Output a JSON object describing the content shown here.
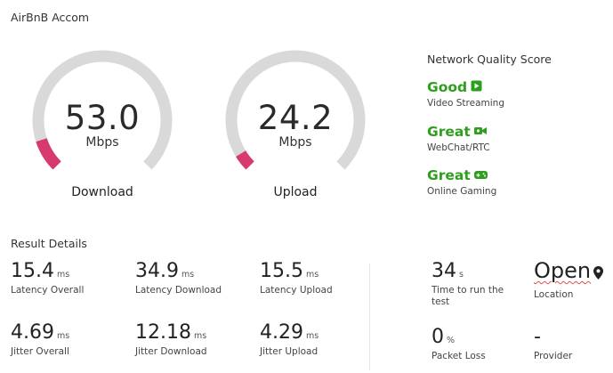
{
  "header": {
    "title": "AirBnB Accom"
  },
  "gauges": {
    "download": {
      "value": "53.0",
      "unit": "Mbps",
      "label": "Download",
      "fraction": 0.1
    },
    "upload": {
      "value": "24.2",
      "unit": "Mbps",
      "label": "Upload",
      "fraction": 0.05
    }
  },
  "network_quality": {
    "heading": "Network Quality Score",
    "items": [
      {
        "grade": "Good",
        "desc": "Video Streaming",
        "icon": "video-play-icon"
      },
      {
        "grade": "Great",
        "desc": "WebChat/RTC",
        "icon": "video-camera-icon"
      },
      {
        "grade": "Great",
        "desc": "Online Gaming",
        "icon": "gamepad-icon"
      }
    ]
  },
  "results": {
    "heading": "Result Details",
    "latency_overall": {
      "value": "15.4",
      "unit": "ms",
      "label": "Latency Overall"
    },
    "latency_download": {
      "value": "34.9",
      "unit": "ms",
      "label": "Latency Download"
    },
    "latency_upload": {
      "value": "15.5",
      "unit": "ms",
      "label": "Latency Upload"
    },
    "jitter_overall": {
      "value": "4.69",
      "unit": "ms",
      "label": "Jitter Overall"
    },
    "jitter_download": {
      "value": "12.18",
      "unit": "ms",
      "label": "Jitter Download"
    },
    "jitter_upload": {
      "value": "4.29",
      "unit": "ms",
      "label": "Jitter Upload"
    },
    "time_to_run": {
      "value": "34",
      "unit": "s",
      "label": "Time to run the test"
    },
    "location": {
      "value": "Open",
      "label": "Location"
    },
    "packet_loss": {
      "value": "0",
      "unit": "%",
      "label": "Packet Loss"
    },
    "provider": {
      "value": "-",
      "label": "Provider"
    }
  },
  "colors": {
    "good": "#2e9e1e",
    "gauge_track": "#d9d9d9",
    "gauge_fill": "#d63a6e"
  }
}
